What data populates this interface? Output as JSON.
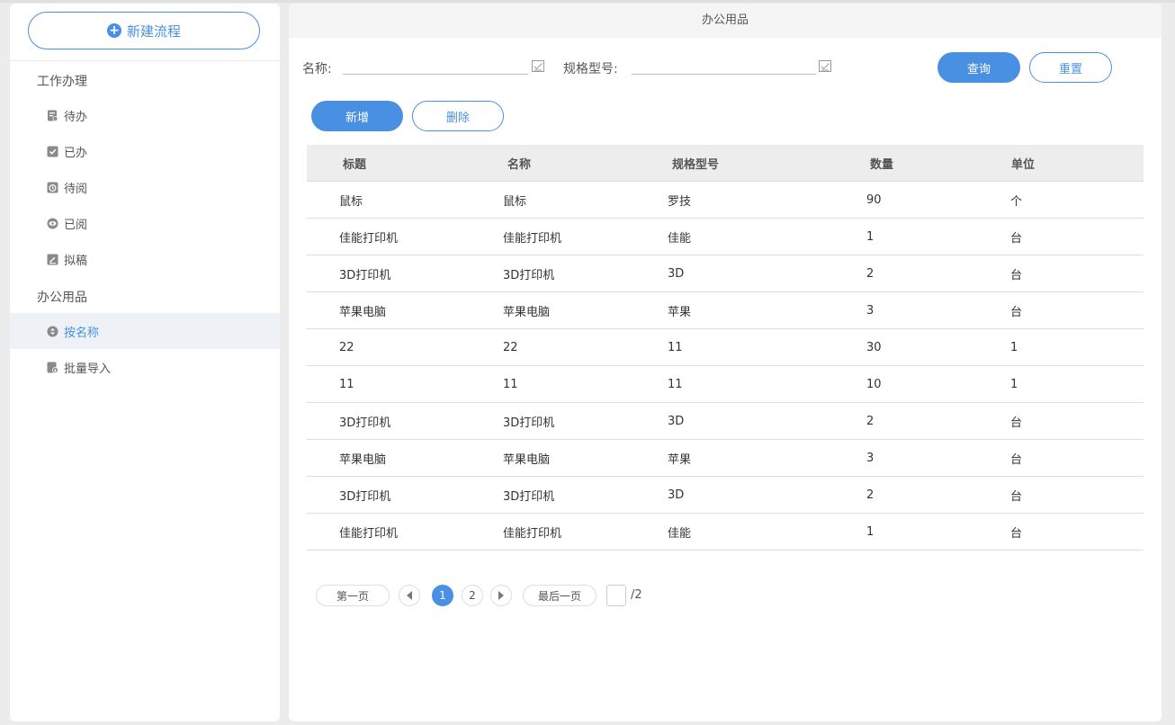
{
  "sidebar": {
    "new_flow_label": "新建流程",
    "groups": [
      {
        "title": "工作办理",
        "items": [
          {
            "label": "待办",
            "icon": "todo-icon"
          },
          {
            "label": "已办",
            "icon": "done-icon"
          },
          {
            "label": "待阅",
            "icon": "to-read-icon"
          },
          {
            "label": "已阅",
            "icon": "eye-icon"
          },
          {
            "label": "拟稿",
            "icon": "draft-icon"
          }
        ]
      },
      {
        "title": "办公用品",
        "items": [
          {
            "label": "按名称",
            "icon": "sort-icon",
            "active": true
          },
          {
            "label": "批量导入",
            "icon": "import-icon"
          }
        ]
      }
    ]
  },
  "main": {
    "title": "办公用品",
    "filters": {
      "name_label": "名称:",
      "name_value": "",
      "spec_label": "规格型号:",
      "spec_value": ""
    },
    "buttons": {
      "query": "查询",
      "reset": "重置",
      "add": "新增",
      "delete": "删除"
    },
    "table": {
      "columns": [
        "标题",
        "名称",
        "规格型号",
        "数量",
        "单位"
      ],
      "rows": [
        [
          "鼠标",
          "鼠标",
          "罗技",
          "90",
          "个"
        ],
        [
          "佳能打印机",
          "佳能打印机",
          "佳能",
          "1",
          "台"
        ],
        [
          "3D打印机",
          "3D打印机",
          "3D",
          "2",
          "台"
        ],
        [
          "苹果电脑",
          "苹果电脑",
          "苹果",
          "3",
          "台"
        ],
        [
          "22",
          "22",
          "11",
          "30",
          "1"
        ],
        [
          "11",
          "11",
          "11",
          "10",
          "1"
        ],
        [
          "3D打印机",
          "3D打印机",
          "3D",
          "2",
          "台"
        ],
        [
          "苹果电脑",
          "苹果电脑",
          "苹果",
          "3",
          "台"
        ],
        [
          "3D打印机",
          "3D打印机",
          "3D",
          "2",
          "台"
        ],
        [
          "佳能打印机",
          "佳能打印机",
          "佳能",
          "1",
          "台"
        ]
      ]
    },
    "pagination": {
      "first": "第一页",
      "last": "最后一页",
      "pages": [
        "1",
        "2"
      ],
      "current": "1",
      "total": "/2"
    }
  },
  "colors": {
    "accent": "#4a90e2",
    "active_bg": "#eef2f7"
  }
}
